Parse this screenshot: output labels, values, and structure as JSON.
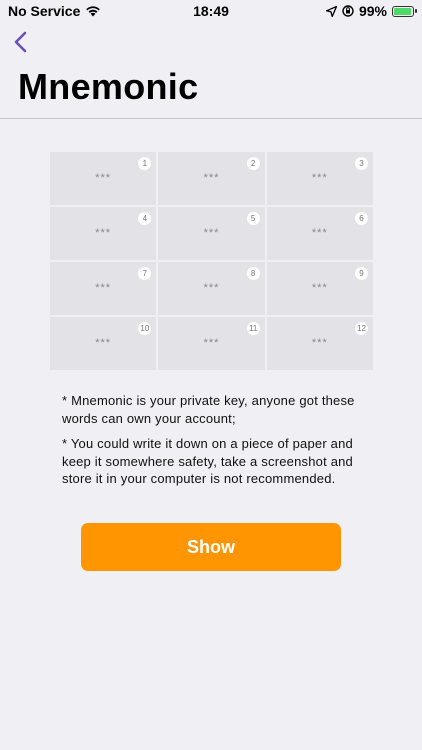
{
  "status_bar": {
    "carrier": "No Service",
    "time": "18:49",
    "battery": "99%"
  },
  "header": {
    "title": "Mnemonic"
  },
  "mnemonic": {
    "words": [
      {
        "num": "1",
        "word": "***"
      },
      {
        "num": "2",
        "word": "***"
      },
      {
        "num": "3",
        "word": "***"
      },
      {
        "num": "4",
        "word": "***"
      },
      {
        "num": "5",
        "word": "***"
      },
      {
        "num": "6",
        "word": "***"
      },
      {
        "num": "7",
        "word": "***"
      },
      {
        "num": "8",
        "word": "***"
      },
      {
        "num": "9",
        "word": "***"
      },
      {
        "num": "10",
        "word": "***"
      },
      {
        "num": "11",
        "word": "***"
      },
      {
        "num": "12",
        "word": "***"
      }
    ]
  },
  "notes": [
    "* Mnemonic is your private key, anyone got these words can own your account;",
    "* You could write it down on a piece of paper and keep it somewhere safety, take a screenshot and store it in your computer is not recommended."
  ],
  "actions": {
    "show_label": "Show"
  },
  "colors": {
    "accent": "#ff9500",
    "back_arrow": "#6b4fbb"
  }
}
